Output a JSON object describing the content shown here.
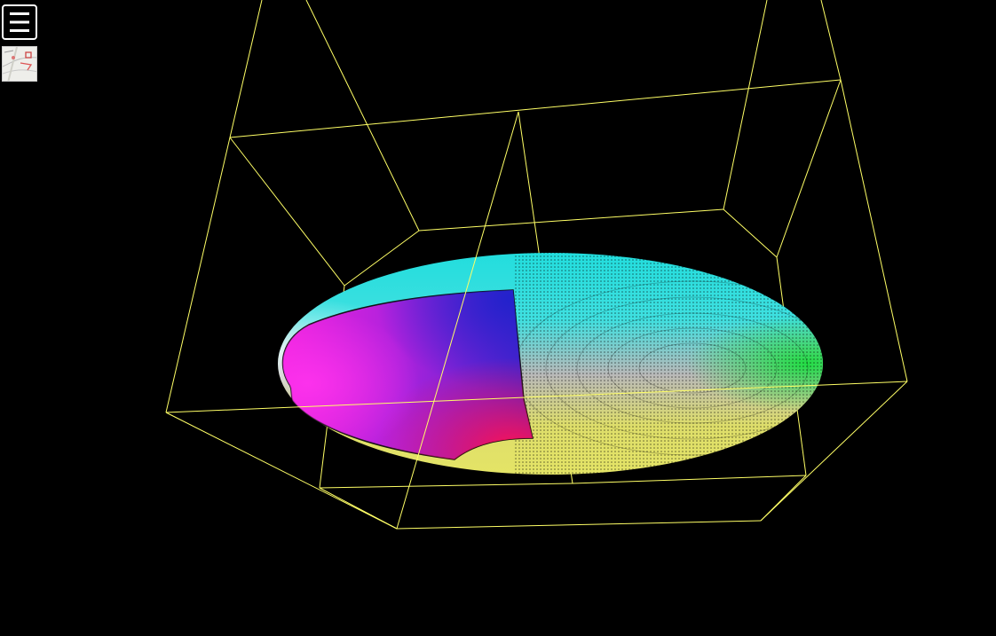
{
  "app": {
    "background_color": "#000000"
  },
  "toolbar": {
    "menu_icon": "hamburger-menu-icon",
    "map_thumbnail_icon": "map-thumbnail-icon"
  },
  "scene": {
    "bounding_box_color": "#ffff66",
    "surface": "colored-spheroid-with-cutaway",
    "colors": {
      "magenta": "#ee22dd",
      "blue": "#2222cc",
      "red": "#ff1155",
      "cyan": "#22dddd",
      "green": "#22dd44",
      "yellow": "#e4e466",
      "gray": "#b9b9b9"
    }
  }
}
